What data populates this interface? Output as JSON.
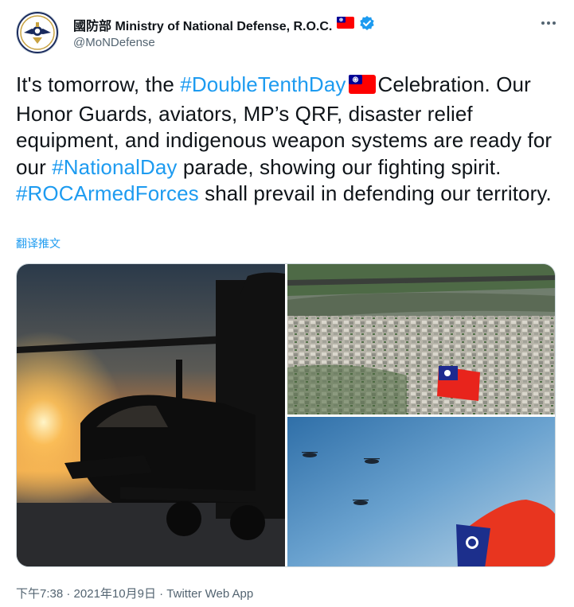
{
  "account": {
    "display_name": "國防部 Ministry of National Defense, R.O.C.",
    "handle": "@MoNDefense",
    "verified_icon": "verified-badge-icon",
    "flag_icon": "taiwan-flag-icon"
  },
  "tweet": {
    "seg1": "It's tomorrow, the ",
    "tag1": "#DoubleTenthDay",
    "seg2": "Celebration. Our Honor Guards, aviators, MP’s QRF, disaster relief equipment, and indigenous weapon systems are ready for our ",
    "tag2": "#NationalDay",
    "seg3": " parade, showing our fighting spirit. ",
    "tag3": "#ROCArmedForces",
    "seg4": " shall prevail in defending our territory."
  },
  "translate_label": "翻译推文",
  "meta": {
    "time": "下午7:38",
    "sep1": " · ",
    "date": "2021年10月9日",
    "sep2": " · ",
    "source": "Twitter Web App"
  },
  "colors": {
    "accent": "#1d9bf0",
    "text": "#0f1419",
    "secondary": "#536471",
    "flag_red": "#fe0000",
    "flag_blue": "#000095"
  }
}
